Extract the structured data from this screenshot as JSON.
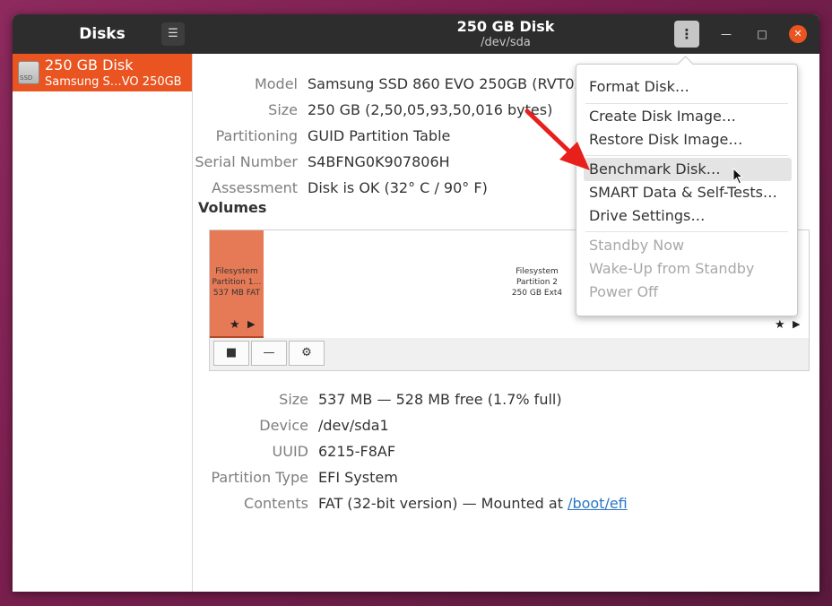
{
  "titlebar": {
    "app_title": "Disks",
    "disk_title": "250 GB Disk",
    "disk_device": "/dev/sda",
    "hamburger_glyph": "☰",
    "kebab_glyph": "⋮",
    "minimize_glyph": "—",
    "maximize_glyph": "□",
    "close_glyph": "✕"
  },
  "sidebar": {
    "items": [
      {
        "name": "250 GB Disk",
        "subtitle": "Samsung S…VO 250GB",
        "icon": "hard-disk-icon",
        "icon_text": "SSD"
      }
    ]
  },
  "drive_info": [
    {
      "label": "Model",
      "value": "Samsung SSD 860 EVO 250GB (RVT02"
    },
    {
      "label": "Size",
      "value": "250 GB (2,50,05,93,50,016 bytes)"
    },
    {
      "label": "Partitioning",
      "value": "GUID Partition Table"
    },
    {
      "label": "Serial Number",
      "value": "S4BFNG0K907806H"
    },
    {
      "label": "Assessment",
      "value": "Disk is OK (32° C / 90° F)"
    }
  ],
  "volumes": {
    "heading": "Volumes",
    "partitions": [
      {
        "line1": "Filesystem",
        "line2": "Partition 1…",
        "line3": "537 MB FAT"
      },
      {
        "line1": "Filesystem",
        "line2": "Partition 2",
        "line3": "250 GB Ext4"
      }
    ],
    "star_glyph": "★",
    "play_glyph": "▶",
    "toolbar": {
      "stop_glyph": "■",
      "remove_glyph": "—",
      "settings_glyph": "⚙"
    }
  },
  "partition_info": [
    {
      "label": "Size",
      "value": "537 MB — 528 MB free (1.7% full)"
    },
    {
      "label": "Device",
      "value": "/dev/sda1"
    },
    {
      "label": "UUID",
      "value": "6215-F8AF"
    },
    {
      "label": "Partition Type",
      "value": "EFI System"
    },
    {
      "label": "Contents",
      "value": "FAT (32-bit version) — Mounted at ",
      "link": "/boot/efi"
    }
  ],
  "menu": {
    "items": [
      {
        "label": "Format Disk…",
        "enabled": true
      },
      {
        "label": "Create Disk Image…",
        "enabled": true
      },
      {
        "label": "Restore Disk Image…",
        "enabled": true
      },
      {
        "label": "Benchmark Disk…",
        "enabled": true,
        "highlighted": true
      },
      {
        "label": "SMART Data & Self-Tests…",
        "enabled": true
      },
      {
        "label": "Drive Settings…",
        "enabled": true
      },
      {
        "label": "Standby Now",
        "enabled": false
      },
      {
        "label": "Wake-Up from Standby",
        "enabled": false
      },
      {
        "label": "Power Off",
        "enabled": false
      }
    ]
  },
  "colors": {
    "accent": "#e95420",
    "partition_fill": "#e67a56",
    "annotation_arrow": "#e8201c",
    "titlebar": "#2d2d2d"
  }
}
